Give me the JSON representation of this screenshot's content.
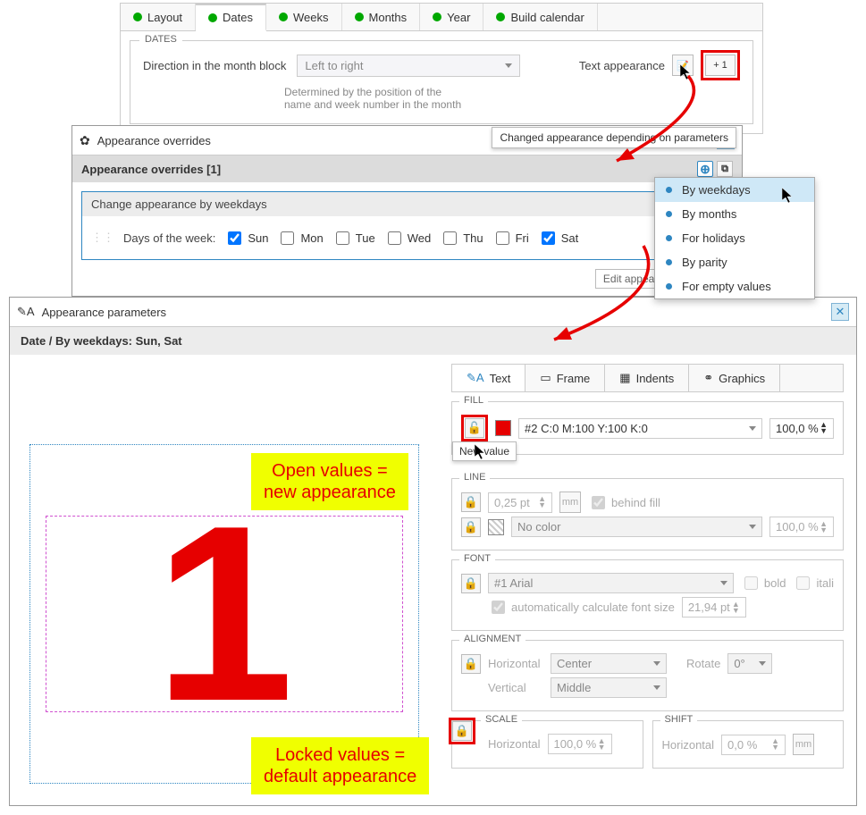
{
  "panel1": {
    "tabs": [
      "Layout",
      "Dates",
      "Weeks",
      "Months",
      "Year",
      "Build calendar"
    ],
    "active_tab": 1,
    "fieldset_title": "DATES",
    "direction_label": "Direction in the month block",
    "direction_value": "Left to right",
    "hint": "Determined by the position of the name and week number in the month",
    "text_appearance_label": "Text appearance",
    "plus_btn": "+ 1",
    "tooltip": "Changed appearance depending on parameters"
  },
  "panel2": {
    "title": "Appearance overrides",
    "subheader": "Appearance overrides  [1]",
    "inner_header": "Change appearance by weekdays",
    "days_label": "Days of the week:",
    "days": [
      {
        "label": "Sun",
        "checked": true
      },
      {
        "label": "Mon",
        "checked": false
      },
      {
        "label": "Tue",
        "checked": false
      },
      {
        "label": "Wed",
        "checked": false
      },
      {
        "label": "Thu",
        "checked": false
      },
      {
        "label": "Fri",
        "checked": false
      },
      {
        "label": "Sat",
        "checked": true
      }
    ],
    "edit_label": "Edit appearance override"
  },
  "dropdown": {
    "items": [
      "By weekdays",
      "By months",
      "For holidays",
      "By parity",
      "For empty values"
    ],
    "selected": 0
  },
  "panel3": {
    "title": "Appearance parameters",
    "breadcrumb": "Date / By weekdays: Sun, Sat",
    "note_open": "Open values =\nnew appearance",
    "note_locked": "Locked values =\ndefault appearance",
    "preview_digit": "1",
    "tabs": [
      "Text",
      "Frame",
      "Indents",
      "Graphics"
    ],
    "active_tab": 0,
    "fill": {
      "title": "FILL",
      "color_label": "#2 C:0 M:100 Y:100 K:0",
      "opacity": "100,0 %",
      "tooltip": "New value"
    },
    "line": {
      "title": "LINE",
      "width": "0,25 pt",
      "unit": "mm",
      "behind_label": "behind fill",
      "behind_checked": true,
      "color": "No color",
      "opacity": "100,0 %"
    },
    "font": {
      "title": "FONT",
      "name": "#1 Arial",
      "bold": "bold",
      "italic": "itali",
      "auto_label": "automatically calculate font size",
      "auto_checked": true,
      "size": "21,94 pt"
    },
    "align": {
      "title": "ALIGNMENT",
      "h_label": "Horizontal",
      "h_val": "Center",
      "v_label": "Vertical",
      "v_val": "Middle",
      "rot_label": "Rotate",
      "rot_val": "0°"
    },
    "scale": {
      "title": "SCALE",
      "h_label": "Horizontal",
      "h_val": "100,0 %"
    },
    "shift": {
      "title": "SHIFT",
      "h_label": "Horizontal",
      "h_val": "0,0 %",
      "unit": "mm"
    }
  }
}
